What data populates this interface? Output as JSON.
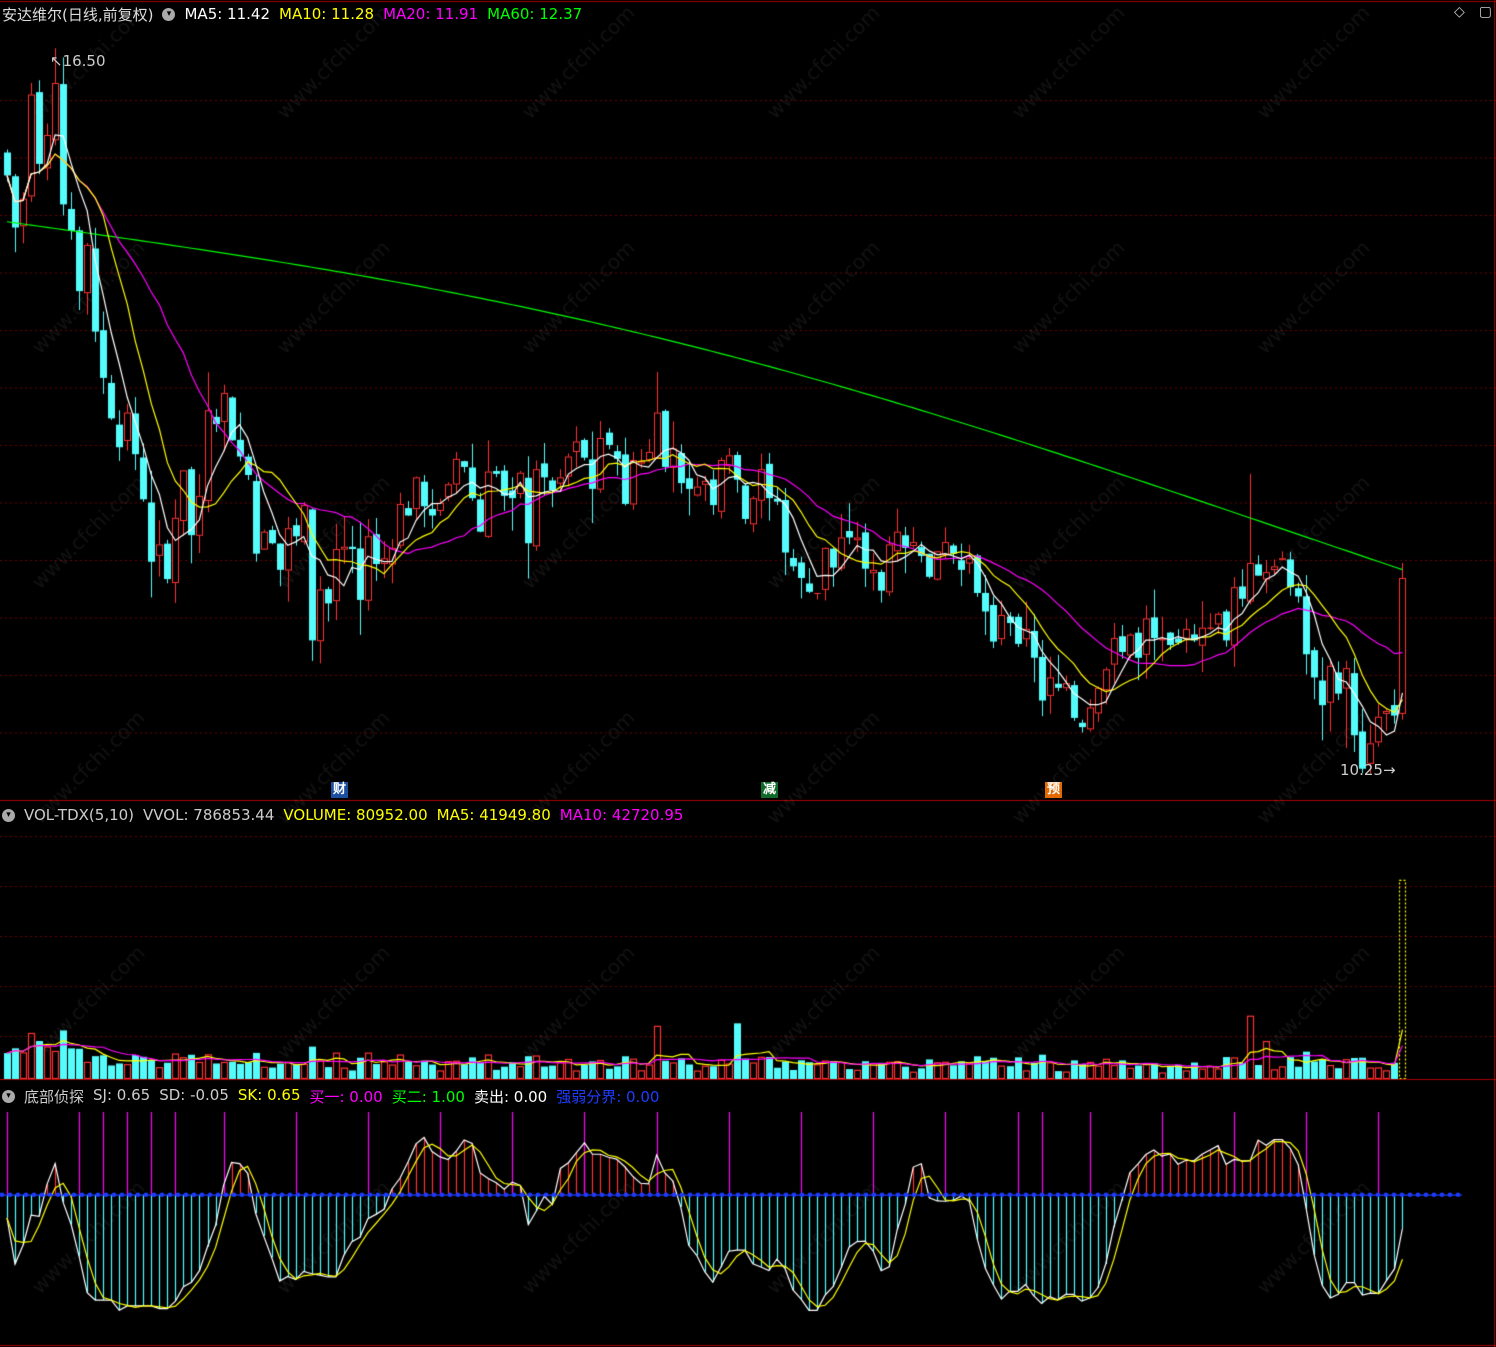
{
  "main": {
    "title": "安达维尔(日线,前复权)",
    "ma": [
      {
        "label": "MA5: 11.42",
        "color": "#ffffff"
      },
      {
        "label": "MA10: 11.28",
        "color": "#ffff00"
      },
      {
        "label": "MA20: 11.91",
        "color": "#ff00ff"
      },
      {
        "label": "MA60: 12.37",
        "color": "#00ff00"
      }
    ],
    "high_label": "16.50",
    "low_label": "10.25",
    "markers": [
      {
        "text": "财",
        "bg": "#1d4fa0",
        "fg": "#ffffff"
      },
      {
        "text": "减",
        "bg": "#0f6a2a",
        "fg": "#ffffff"
      },
      {
        "text": "预",
        "bg": "#e26a00",
        "fg": "#ffffff"
      }
    ],
    "icons": [
      "diamond-icon",
      "window-icon"
    ]
  },
  "volume": {
    "title": "VOL-TDX(5,10)",
    "items": [
      {
        "label": "VVOL: 786853.44",
        "color": "#cccccc"
      },
      {
        "label": "VOLUME: 80952.00",
        "color": "#ffff00"
      },
      {
        "label": "MA5: 41949.80",
        "color": "#ffff00"
      },
      {
        "label": "MA10: 42720.95",
        "color": "#ff00ff"
      }
    ]
  },
  "indicator": {
    "title": "底部侦探",
    "items": [
      {
        "label": "SJ: 0.65",
        "color": "#cccccc"
      },
      {
        "label": "SD: -0.05",
        "color": "#cccccc"
      },
      {
        "label": "SK: 0.65",
        "color": "#ffff00"
      },
      {
        "label": "买一: 0.00",
        "color": "#ff00ff"
      },
      {
        "label": "买二: 1.00",
        "color": "#00ff00"
      },
      {
        "label": "卖出: 0.00",
        "color": "#ffffff"
      },
      {
        "label": "强弱分界: 0.00",
        "color": "#1e3cff"
      }
    ]
  },
  "chart_data": {
    "type": "candlestick",
    "colors": {
      "up": "#ff3232",
      "down": "#54fcfc",
      "ma5": "#ffffff",
      "ma10": "#ffff00",
      "ma20": "#ff00ff",
      "ma60": "#00ff00"
    },
    "price_range": [
      10.0,
      16.9
    ],
    "close": [
      15.4,
      14.95,
      15.2,
      16.1,
      15.5,
      15.75,
      16.2,
      15.15,
      14.92,
      14.4,
      14.8,
      14.05,
      13.65,
      13.3,
      13.05,
      13.35,
      12.99,
      12.6,
      12.06,
      12.21,
      11.91,
      12.44,
      12.85,
      12.29,
      12.63,
      13.37,
      13.25,
      13.52,
      13.11,
      12.97,
      12.81,
      12.13,
      12.32,
      12.22,
      11.99,
      12.35,
      12.28,
      12.55,
      11.38,
      11.82,
      11.7,
      12.17,
      12.19,
      12.17,
      11.73,
      12.28,
      12.04,
      12.09,
      12.18,
      12.56,
      12.46,
      12.79,
      12.54,
      12.46,
      12.57,
      12.73,
      12.95,
      12.88,
      12.61,
      12.32,
      12.84,
      12.82,
      12.63,
      12.61,
      12.83,
      12.22,
      12.86,
      12.79,
      12.68,
      12.79,
      12.97,
      13.1,
      12.96,
      12.69,
      13.13,
      13.07,
      12.95,
      12.56,
      12.94,
      12.93,
      13.01,
      13.35,
      12.88,
      13.04,
      12.74,
      12.69,
      12.71,
      12.76,
      12.55,
      12.94,
      12.98,
      12.77,
      12.43,
      12.61,
      12.86,
      12.61,
      12.58,
      12.14,
      12.02,
      11.92,
      11.8,
      11.79,
      12.18,
      12.01,
      12.27,
      12.27,
      12.27,
      12.0,
      11.99,
      11.81,
      12.21,
      12.32,
      12.18,
      12.23,
      12.11,
      11.93,
      12.15,
      12.23,
      12.13,
      11.99,
      12.09,
      11.79,
      11.63,
      11.37,
      11.6,
      11.53,
      11.35,
      11.48,
      11.23,
      10.86,
      11.06,
      10.97,
      11.01,
      10.71,
      10.63,
      10.8,
      10.97,
      11.13,
      11.4,
      11.28,
      11.43,
      11.23,
      11.57,
      11.4,
      11.39,
      11.34,
      11.36,
      11.48,
      11.38,
      11.49,
      11.49,
      11.61,
      11.38,
      11.84,
      11.74,
      12.05,
      11.94,
      11.97,
      12.02,
      12.09,
      11.84,
      11.76,
      11.26,
      11.06,
      10.82,
      11.16,
      10.92,
      11.14,
      10.56,
      10.27,
      10.49,
      10.72,
      10.77,
      10.73,
      11.92
    ],
    "ma60_end": 12.37,
    "volume_range": [
      0,
      1000000
    ],
    "indicator_range": [
      -1.3,
      0.75
    ]
  }
}
